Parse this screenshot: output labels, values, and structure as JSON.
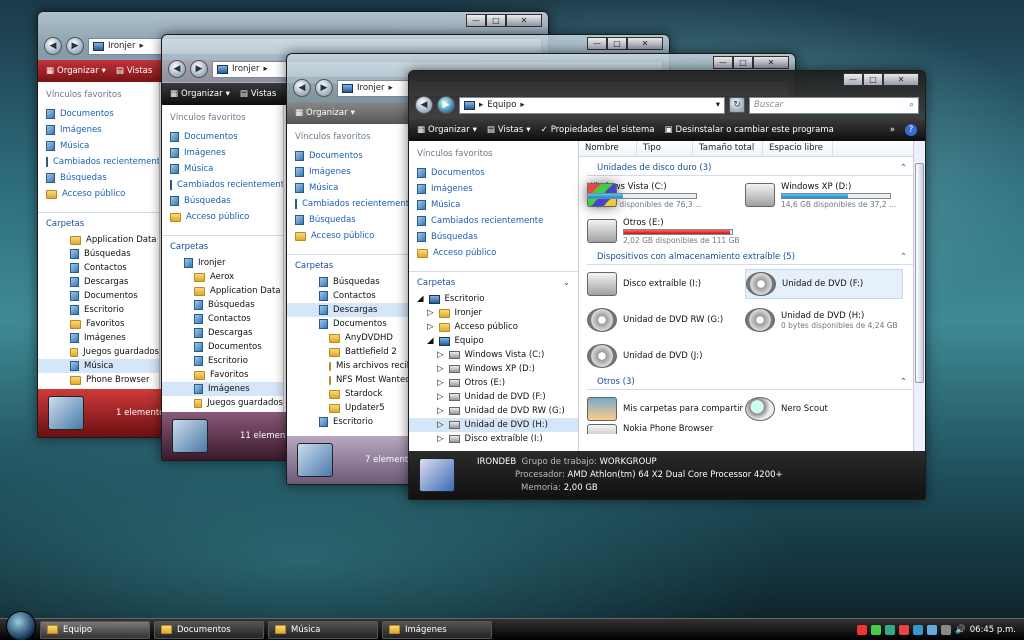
{
  "colors": {
    "accent": "#1a5fb4",
    "toolbar_dark": "#0e0e0e",
    "toolbar_red": "#7a1216"
  },
  "windows": {
    "w1": {
      "address": [
        "Ironjer"
      ],
      "toolbar": [
        "Organizar",
        "Vistas"
      ],
      "fav_head": "Vínculos favoritos",
      "favs": [
        "Documentos",
        "Imágenes",
        "Música",
        "Cambiados recientemente",
        "Búsquedas",
        "Acceso público"
      ],
      "folders_head": "Carpetas",
      "tree": [
        "Application Data",
        "Búsquedas",
        "Contactos",
        "Descargas",
        "Documentos",
        "Escritorio",
        "Favoritos",
        "Imágenes",
        "Juegos guardados",
        "Música",
        "Phone Browser"
      ],
      "status": "1 elemento"
    },
    "w2": {
      "address": [
        "Ironjer"
      ],
      "toolbar": [
        "Organizar",
        "Vistas"
      ],
      "fav_head": "Vínculos favoritos",
      "favs": [
        "Documentos",
        "Imágenes",
        "Música",
        "Cambiados recientemente",
        "Búsquedas",
        "Acceso público"
      ],
      "folders_head": "Carpetas",
      "tree": [
        "Ironjer",
        "Aerox",
        "Application Data",
        "Búsquedas",
        "Contactos",
        "Descargas",
        "Documentos",
        "Escritorio",
        "Favoritos",
        "Imágenes",
        "Juegos guardados"
      ],
      "status": "11 elementos"
    },
    "w3": {
      "address": [
        "Ironjer"
      ],
      "toolbar": [
        "Organizar"
      ],
      "fav_head": "Vínculos favoritos",
      "favs": [
        "Documentos",
        "Imágenes",
        "Música",
        "Cambiados recientemente",
        "Búsquedas",
        "Acceso público"
      ],
      "folders_head": "Carpetas",
      "tree": [
        "Búsquedas",
        "Contactos",
        "Descargas",
        "Documentos",
        "AnyDVDHD",
        "Battlefield 2",
        "Mis archivos recib",
        "NFS Most Wanted",
        "Stardock",
        "Updater5",
        "Escritorio"
      ],
      "status": "7 elementos"
    },
    "w4": {
      "address": [
        "Equipo"
      ],
      "search_placeholder": "Buscar",
      "toolbar": [
        "Organizar",
        "Vistas",
        "Propiedades del sistema",
        "Desinstalar o cambiar este programa"
      ],
      "fav_head": "Vínculos favoritos",
      "favs": [
        "Documentos",
        "Imágenes",
        "Música",
        "Cambiados recientemente",
        "Búsquedas",
        "Acceso público"
      ],
      "folders_head": "Carpetas",
      "tree": [
        "Escritorio",
        "Ironjer",
        "Acceso público",
        "Equipo",
        "Windows Vista (C:)",
        "Windows XP (D:)",
        "Otros (E:)",
        "Unidad de DVD (F:)",
        "Unidad de DVD RW (G:)",
        "Unidad de DVD (H:)",
        "Disco extraíble (I:)"
      ],
      "columns": [
        "Nombre",
        "Tipo",
        "Tamaño total",
        "Espacio libre"
      ],
      "groups": {
        "hdd": "Unidades de disco duro (3)",
        "removable": "Dispositivos con almacenamiento extraíble (5)",
        "others": "Otros (3)"
      },
      "hdd": [
        {
          "name": "Windows Vista (C:)",
          "sub": "52,2 GB disponibles de 76,3 ...",
          "used": 0.32
        },
        {
          "name": "Windows XP (D:)",
          "sub": "14,6 GB disponibles de 37,2 ...",
          "used": 0.61
        },
        {
          "name": "Otros (E:)",
          "sub": "2,02 GB disponibles de 111 GB",
          "used": 0.98
        }
      ],
      "removable": [
        {
          "name": "Disco extraíble (I:)",
          "sub": ""
        },
        {
          "name": "Unidad de DVD (F:)",
          "sub": ""
        },
        {
          "name": "Unidad de DVD RW (G:)",
          "sub": ""
        },
        {
          "name": "Unidad de DVD (H:)",
          "sub": "0 bytes disponibles de 4,24 GB"
        },
        {
          "name": "Unidad de DVD (J:)",
          "sub": ""
        }
      ],
      "others": [
        {
          "name": "Mis carpetas para compartir"
        },
        {
          "name": "Nero Scout"
        },
        {
          "name": "Nokia Phone Browser"
        }
      ],
      "details": {
        "computer": "IRONDEB",
        "workgroup_label": "Grupo de trabajo:",
        "workgroup": "WORKGROUP",
        "cpu_label": "Procesador:",
        "cpu": "AMD Athlon(tm) 64 X2 Dual Core Processor 4200+",
        "mem_label": "Memoria:",
        "mem": "2,00 GB"
      }
    }
  },
  "taskbar": {
    "tasks": [
      "Equipo",
      "Documentos",
      "Música",
      "Imágenes"
    ],
    "clock": "06:45 p.m."
  }
}
